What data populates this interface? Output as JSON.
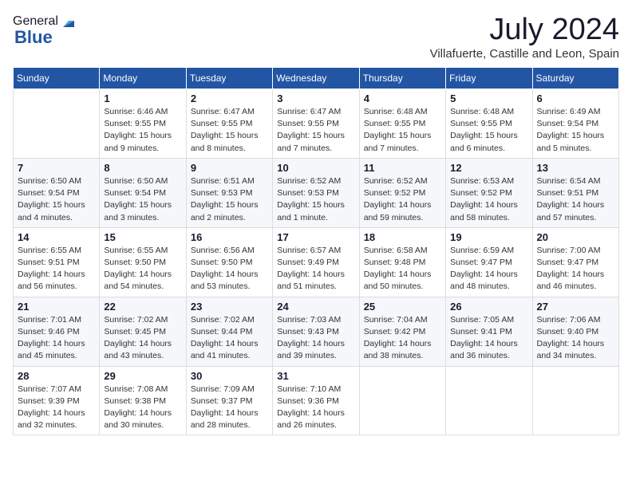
{
  "header": {
    "logo_general": "General",
    "logo_blue": "Blue",
    "month_title": "July 2024",
    "location": "Villafuerte, Castille and Leon, Spain"
  },
  "days_of_week": [
    "Sunday",
    "Monday",
    "Tuesday",
    "Wednesday",
    "Thursday",
    "Friday",
    "Saturday"
  ],
  "weeks": [
    [
      {
        "day": "",
        "info": ""
      },
      {
        "day": "1",
        "info": "Sunrise: 6:46 AM\nSunset: 9:55 PM\nDaylight: 15 hours\nand 9 minutes."
      },
      {
        "day": "2",
        "info": "Sunrise: 6:47 AM\nSunset: 9:55 PM\nDaylight: 15 hours\nand 8 minutes."
      },
      {
        "day": "3",
        "info": "Sunrise: 6:47 AM\nSunset: 9:55 PM\nDaylight: 15 hours\nand 7 minutes."
      },
      {
        "day": "4",
        "info": "Sunrise: 6:48 AM\nSunset: 9:55 PM\nDaylight: 15 hours\nand 7 minutes."
      },
      {
        "day": "5",
        "info": "Sunrise: 6:48 AM\nSunset: 9:55 PM\nDaylight: 15 hours\nand 6 minutes."
      },
      {
        "day": "6",
        "info": "Sunrise: 6:49 AM\nSunset: 9:54 PM\nDaylight: 15 hours\nand 5 minutes."
      }
    ],
    [
      {
        "day": "7",
        "info": "Sunrise: 6:50 AM\nSunset: 9:54 PM\nDaylight: 15 hours\nand 4 minutes."
      },
      {
        "day": "8",
        "info": "Sunrise: 6:50 AM\nSunset: 9:54 PM\nDaylight: 15 hours\nand 3 minutes."
      },
      {
        "day": "9",
        "info": "Sunrise: 6:51 AM\nSunset: 9:53 PM\nDaylight: 15 hours\nand 2 minutes."
      },
      {
        "day": "10",
        "info": "Sunrise: 6:52 AM\nSunset: 9:53 PM\nDaylight: 15 hours\nand 1 minute."
      },
      {
        "day": "11",
        "info": "Sunrise: 6:52 AM\nSunset: 9:52 PM\nDaylight: 14 hours\nand 59 minutes."
      },
      {
        "day": "12",
        "info": "Sunrise: 6:53 AM\nSunset: 9:52 PM\nDaylight: 14 hours\nand 58 minutes."
      },
      {
        "day": "13",
        "info": "Sunrise: 6:54 AM\nSunset: 9:51 PM\nDaylight: 14 hours\nand 57 minutes."
      }
    ],
    [
      {
        "day": "14",
        "info": "Sunrise: 6:55 AM\nSunset: 9:51 PM\nDaylight: 14 hours\nand 56 minutes."
      },
      {
        "day": "15",
        "info": "Sunrise: 6:55 AM\nSunset: 9:50 PM\nDaylight: 14 hours\nand 54 minutes."
      },
      {
        "day": "16",
        "info": "Sunrise: 6:56 AM\nSunset: 9:50 PM\nDaylight: 14 hours\nand 53 minutes."
      },
      {
        "day": "17",
        "info": "Sunrise: 6:57 AM\nSunset: 9:49 PM\nDaylight: 14 hours\nand 51 minutes."
      },
      {
        "day": "18",
        "info": "Sunrise: 6:58 AM\nSunset: 9:48 PM\nDaylight: 14 hours\nand 50 minutes."
      },
      {
        "day": "19",
        "info": "Sunrise: 6:59 AM\nSunset: 9:47 PM\nDaylight: 14 hours\nand 48 minutes."
      },
      {
        "day": "20",
        "info": "Sunrise: 7:00 AM\nSunset: 9:47 PM\nDaylight: 14 hours\nand 46 minutes."
      }
    ],
    [
      {
        "day": "21",
        "info": "Sunrise: 7:01 AM\nSunset: 9:46 PM\nDaylight: 14 hours\nand 45 minutes."
      },
      {
        "day": "22",
        "info": "Sunrise: 7:02 AM\nSunset: 9:45 PM\nDaylight: 14 hours\nand 43 minutes."
      },
      {
        "day": "23",
        "info": "Sunrise: 7:02 AM\nSunset: 9:44 PM\nDaylight: 14 hours\nand 41 minutes."
      },
      {
        "day": "24",
        "info": "Sunrise: 7:03 AM\nSunset: 9:43 PM\nDaylight: 14 hours\nand 39 minutes."
      },
      {
        "day": "25",
        "info": "Sunrise: 7:04 AM\nSunset: 9:42 PM\nDaylight: 14 hours\nand 38 minutes."
      },
      {
        "day": "26",
        "info": "Sunrise: 7:05 AM\nSunset: 9:41 PM\nDaylight: 14 hours\nand 36 minutes."
      },
      {
        "day": "27",
        "info": "Sunrise: 7:06 AM\nSunset: 9:40 PM\nDaylight: 14 hours\nand 34 minutes."
      }
    ],
    [
      {
        "day": "28",
        "info": "Sunrise: 7:07 AM\nSunset: 9:39 PM\nDaylight: 14 hours\nand 32 minutes."
      },
      {
        "day": "29",
        "info": "Sunrise: 7:08 AM\nSunset: 9:38 PM\nDaylight: 14 hours\nand 30 minutes."
      },
      {
        "day": "30",
        "info": "Sunrise: 7:09 AM\nSunset: 9:37 PM\nDaylight: 14 hours\nand 28 minutes."
      },
      {
        "day": "31",
        "info": "Sunrise: 7:10 AM\nSunset: 9:36 PM\nDaylight: 14 hours\nand 26 minutes."
      },
      {
        "day": "",
        "info": ""
      },
      {
        "day": "",
        "info": ""
      },
      {
        "day": "",
        "info": ""
      }
    ]
  ]
}
